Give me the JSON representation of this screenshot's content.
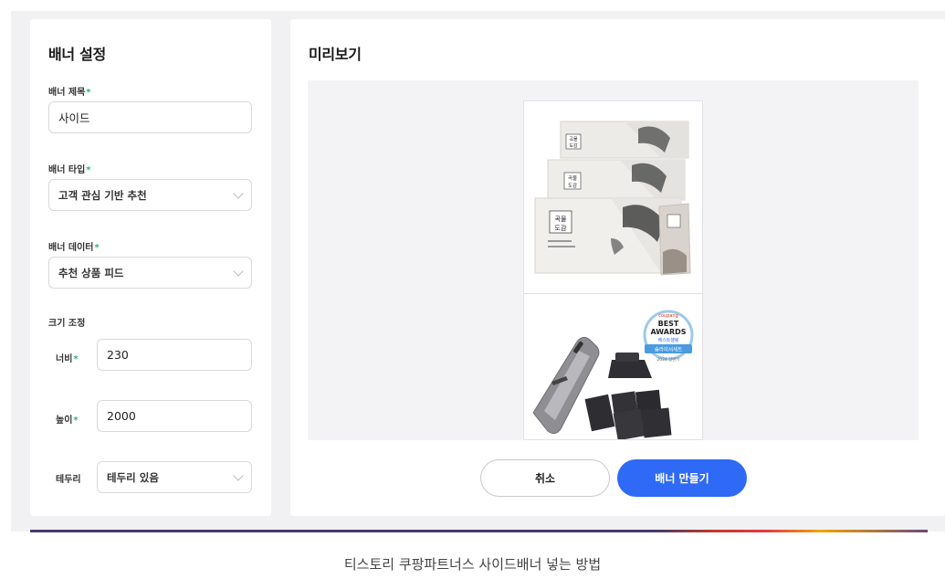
{
  "settings": {
    "title": "배너 설정",
    "banner_title": {
      "label": "배너 제목",
      "required": "*",
      "value": "사이드"
    },
    "banner_type": {
      "label": "배너 타입",
      "required": "*",
      "value": "고객 관심 기반 추천"
    },
    "banner_data": {
      "label": "배너 데이터",
      "required": "*",
      "value": "추천 상품 피드"
    },
    "size": {
      "label": "크기 조정",
      "width_label": "너비",
      "width_required": "*",
      "width_value": "230",
      "height_label": "높이",
      "height_required": "*",
      "height_value": "2000"
    },
    "border": {
      "label": "테두리",
      "value": "테두리 있음"
    }
  },
  "preview": {
    "title": "미리보기",
    "product1": {
      "box_text_top": "곡물",
      "box_text_bottom": "도감"
    },
    "product2": {
      "badge_brand": "coupang",
      "badge_line1": "BEST",
      "badge_line2": "AWARDS",
      "badge_line3": "베스트셀링",
      "badge_ribbon": "슬라이서세트",
      "badge_year": "2024 상반기"
    }
  },
  "actions": {
    "cancel_label": "취소",
    "create_label": "배너 만들기"
  },
  "caption": "티스토리 쿠팡파트너스 사이드배너 넣는 방법",
  "colors": {
    "accent": "#2f6af6",
    "required": "#2bb673",
    "panel_bg": "#f1f1f3"
  }
}
